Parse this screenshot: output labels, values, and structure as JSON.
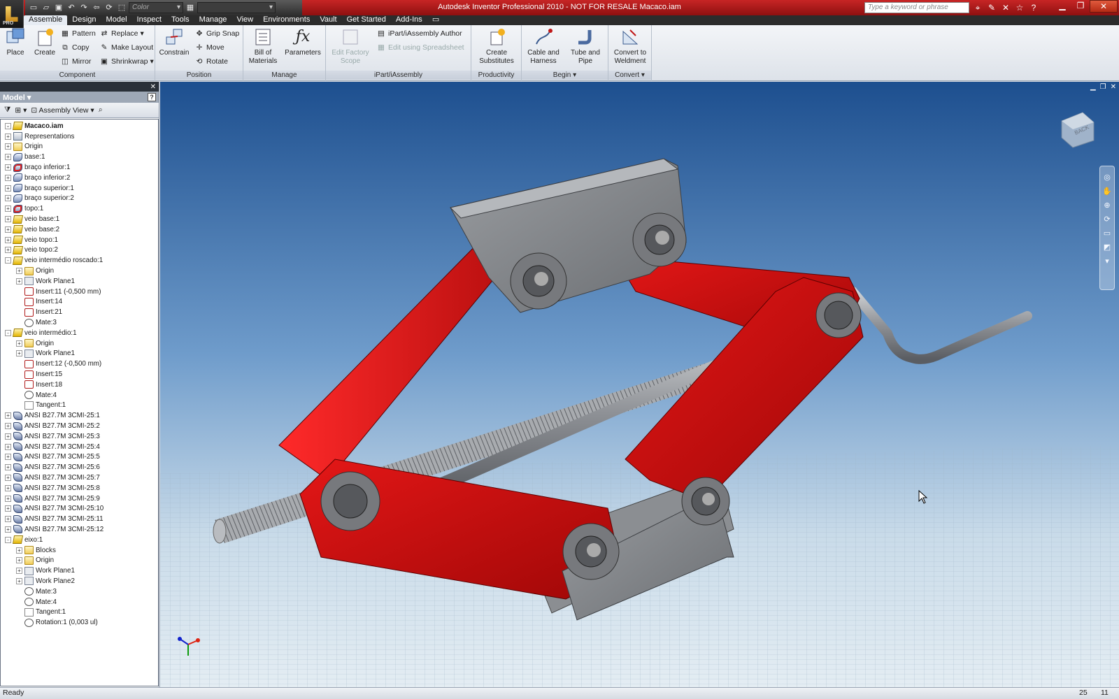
{
  "title_bar": {
    "window_title": "Autodesk Inventor Professional 2010 - NOT FOR RESALE      Macaco.iam",
    "app_badge": "PRO",
    "color_selector": "Color",
    "search_placeholder": "Type a keyword or phrase",
    "accent_color": "#b31818"
  },
  "tabs": [
    "Assemble",
    "Design",
    "Model",
    "Inspect",
    "Tools",
    "Manage",
    "View",
    "Environments",
    "Vault",
    "Get Started",
    "Add-Ins"
  ],
  "active_tab": "Assemble",
  "ribbon": {
    "component": {
      "title": "Component",
      "place": "Place",
      "create": "Create",
      "pattern": "Pattern",
      "copy": "Copy",
      "mirror": "Mirror",
      "replace": "Replace",
      "make_layout": "Make Layout",
      "shrinkwrap": "Shrinkwrap"
    },
    "position": {
      "title": "Position",
      "constrain": "Constrain",
      "grip_snap": "Grip Snap",
      "move": "Move",
      "rotate": "Rotate"
    },
    "manage": {
      "title": "Manage",
      "bom_line1": "Bill of",
      "bom_line2": "Materials",
      "parameters": "Parameters"
    },
    "ipart": {
      "title": "iPart/iAssembly",
      "edit_factory_line1": "Edit Factory",
      "edit_factory_line2": "Scope",
      "author": "iPart/iAssembly Author",
      "spreadsheet": "Edit using Spreadsheet"
    },
    "productivity": {
      "title": "Productivity",
      "line1": "Create",
      "line2": "Substitutes"
    },
    "begin": {
      "title": "Begin",
      "cable_line1": "Cable and",
      "cable_line2": "Harness",
      "tube_line1": "Tube and",
      "tube_line2": "Pipe"
    },
    "convert": {
      "title": "Convert",
      "line1": "Convert to",
      "line2": "Weldment"
    }
  },
  "browser": {
    "header": "Model",
    "view_selector": "Assembly View",
    "tree": [
      {
        "label": "Macaco.iam",
        "icon": "assembly-icon",
        "depth": 0,
        "exp": "-",
        "root": true
      },
      {
        "label": "Representations",
        "icon": "representations-icon",
        "depth": 0,
        "exp": "+"
      },
      {
        "label": "Origin",
        "icon": "folder-icon",
        "depth": 0,
        "exp": "+"
      },
      {
        "label": "base:1",
        "icon": "part-icon",
        "depth": 0,
        "exp": "+"
      },
      {
        "label": "braço inferior:1",
        "icon": "part-red-icon",
        "depth": 0,
        "exp": "+"
      },
      {
        "label": "braço inferior:2",
        "icon": "part-icon",
        "depth": 0,
        "exp": "+"
      },
      {
        "label": "braço superior:1",
        "icon": "part-icon",
        "depth": 0,
        "exp": "+"
      },
      {
        "label": "braço superior:2",
        "icon": "part-icon",
        "depth": 0,
        "exp": "+"
      },
      {
        "label": "topo:1",
        "icon": "part-red-icon",
        "depth": 0,
        "exp": "+"
      },
      {
        "label": "veio base:1",
        "icon": "subassembly-icon",
        "depth": 0,
        "exp": "+"
      },
      {
        "label": "veio base:2",
        "icon": "subassembly-icon",
        "depth": 0,
        "exp": "+"
      },
      {
        "label": "veio topo:1",
        "icon": "subassembly-icon",
        "depth": 0,
        "exp": "+"
      },
      {
        "label": "veio topo:2",
        "icon": "subassembly-icon",
        "depth": 0,
        "exp": "+"
      },
      {
        "label": "veio intermédio roscado:1",
        "icon": "subassembly-icon",
        "depth": 0,
        "exp": "-"
      },
      {
        "label": "Origin",
        "icon": "folder-icon",
        "depth": 1,
        "exp": "+"
      },
      {
        "label": "Work Plane1",
        "icon": "workplane-icon",
        "depth": 1,
        "exp": "+"
      },
      {
        "label": "Insert:11 (-0,500 mm)",
        "icon": "insert-constraint-icon",
        "depth": 1,
        "exp": ""
      },
      {
        "label": "Insert:14",
        "icon": "insert-constraint-icon",
        "depth": 1,
        "exp": ""
      },
      {
        "label": "Insert:21",
        "icon": "insert-constraint-icon",
        "depth": 1,
        "exp": ""
      },
      {
        "label": "Mate:3",
        "icon": "mate-constraint-icon",
        "depth": 1,
        "exp": ""
      },
      {
        "label": "veio intermédio:1",
        "icon": "subassembly-icon",
        "depth": 0,
        "exp": "-"
      },
      {
        "label": "Origin",
        "icon": "folder-icon",
        "depth": 1,
        "exp": "+"
      },
      {
        "label": "Work Plane1",
        "icon": "workplane-icon",
        "depth": 1,
        "exp": "+"
      },
      {
        "label": "Insert:12 (-0,500 mm)",
        "icon": "insert-constraint-icon",
        "depth": 1,
        "exp": ""
      },
      {
        "label": "Insert:15",
        "icon": "insert-constraint-icon",
        "depth": 1,
        "exp": ""
      },
      {
        "label": "Insert:18",
        "icon": "insert-constraint-icon",
        "depth": 1,
        "exp": ""
      },
      {
        "label": "Mate:4",
        "icon": "mate-constraint-icon",
        "depth": 1,
        "exp": ""
      },
      {
        "label": "Tangent:1",
        "icon": "tangent-constraint-icon",
        "depth": 1,
        "exp": ""
      },
      {
        "label": "ANSI B27.7M 3CMI-25:1",
        "icon": "library-part-icon",
        "depth": 0,
        "exp": "+"
      },
      {
        "label": "ANSI B27.7M 3CMI-25:2",
        "icon": "library-part-icon",
        "depth": 0,
        "exp": "+"
      },
      {
        "label": "ANSI B27.7M 3CMI-25:3",
        "icon": "library-part-icon",
        "depth": 0,
        "exp": "+"
      },
      {
        "label": "ANSI B27.7M 3CMI-25:4",
        "icon": "library-part-icon",
        "depth": 0,
        "exp": "+"
      },
      {
        "label": "ANSI B27.7M 3CMI-25:5",
        "icon": "library-part-icon",
        "depth": 0,
        "exp": "+"
      },
      {
        "label": "ANSI B27.7M 3CMI-25:6",
        "icon": "library-part-icon",
        "depth": 0,
        "exp": "+"
      },
      {
        "label": "ANSI B27.7M 3CMI-25:7",
        "icon": "library-part-icon",
        "depth": 0,
        "exp": "+"
      },
      {
        "label": "ANSI B27.7M 3CMI-25:8",
        "icon": "library-part-icon",
        "depth": 0,
        "exp": "+"
      },
      {
        "label": "ANSI B27.7M 3CMI-25:9",
        "icon": "library-part-icon",
        "depth": 0,
        "exp": "+"
      },
      {
        "label": "ANSI B27.7M 3CMI-25:10",
        "icon": "library-part-icon",
        "depth": 0,
        "exp": "+"
      },
      {
        "label": "ANSI B27.7M 3CMI-25:11",
        "icon": "library-part-icon",
        "depth": 0,
        "exp": "+"
      },
      {
        "label": "ANSI B27.7M 3CMI-25:12",
        "icon": "library-part-icon",
        "depth": 0,
        "exp": "+"
      },
      {
        "label": "eixo:1",
        "icon": "subassembly-icon",
        "depth": 0,
        "exp": "-"
      },
      {
        "label": "Blocks",
        "icon": "folder-icon",
        "depth": 1,
        "exp": "+"
      },
      {
        "label": "Origin",
        "icon": "folder-icon",
        "depth": 1,
        "exp": "+"
      },
      {
        "label": "Work Plane1",
        "icon": "workplane-icon",
        "depth": 1,
        "exp": "+"
      },
      {
        "label": "Work Plane2",
        "icon": "workplane-icon",
        "depth": 1,
        "exp": "+"
      },
      {
        "label": "Mate:3",
        "icon": "mate-constraint-icon",
        "depth": 1,
        "exp": ""
      },
      {
        "label": "Mate:4",
        "icon": "mate-constraint-icon",
        "depth": 1,
        "exp": ""
      },
      {
        "label": "Tangent:1",
        "icon": "tangent-constraint-icon",
        "depth": 1,
        "exp": ""
      },
      {
        "label": "Rotation:1 (0,003 ul)",
        "icon": "rotation-constraint-icon",
        "depth": 1,
        "exp": ""
      }
    ]
  },
  "viewcube_label": "BACK",
  "model_colors": {
    "arm_red": "#c80f0f",
    "steel_gray": "#7f8286",
    "background_top": "#1d4f8f",
    "background_bottom": "#e4edf3"
  },
  "status": {
    "message": "Ready",
    "count_a": "25",
    "count_b": "11"
  }
}
